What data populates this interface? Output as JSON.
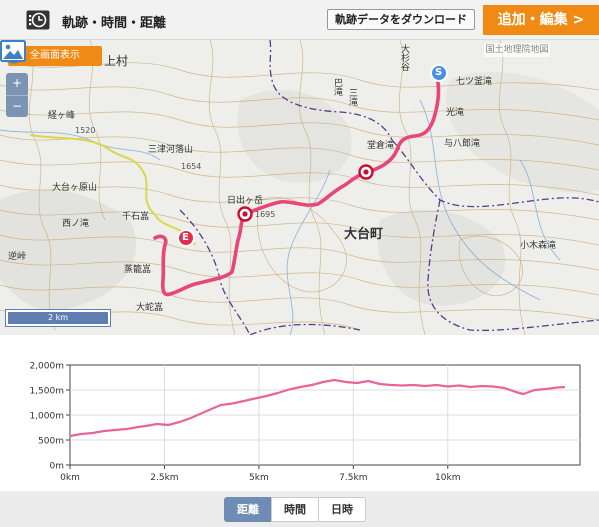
{
  "header": {
    "title": "軌跡・時間・距離",
    "download_label": "軌跡データをダウンロード",
    "edit_label": "追加・編集 >"
  },
  "map": {
    "fullscreen_label": "全画面表示",
    "zoom_in": "+",
    "zoom_out": "−",
    "attribution": "国土地理院地図",
    "scale_label": "2 km",
    "start_marker": "S",
    "end_marker": "E",
    "places": {
      "p1": "上村",
      "p2": "経ヶ峰",
      "p3": "三津河落山",
      "p4": "大台ヶ原山",
      "p5": "西ノ滝",
      "p6": "千石嵓",
      "p7": "逆峠",
      "p8": "蒸籠嵓",
      "p9": "大蛇嵓",
      "p10": "日出ヶ岳",
      "p11": "大台町",
      "p12": "堂倉滝",
      "p13": "与八郎滝",
      "p14": "光滝",
      "p15": "七ツ釜滝",
      "p16": "小木森滝",
      "p17": "巴滝",
      "p18": "三滝",
      "p19": "大杉谷"
    },
    "elevations": {
      "e1": "1520",
      "e2": "1654",
      "e3": "1695"
    }
  },
  "footer": {
    "tabs": [
      {
        "label": "距離",
        "active": true
      },
      {
        "label": "時間",
        "active": false
      },
      {
        "label": "日時",
        "active": false
      }
    ]
  },
  "colors": {
    "track": "#e8457a",
    "accent": "#ef8a14",
    "tab_active": "#6f8cb4",
    "profile": "#e8649a"
  },
  "chart_data": {
    "type": "line",
    "xlabel": "",
    "ylabel": "",
    "xlim": [
      0,
      13.5
    ],
    "ylim": [
      0,
      2000
    ],
    "x_ticks": [
      "0km",
      "2.5km",
      "5km",
      "7.5km",
      "10km"
    ],
    "y_ticks": [
      "0m",
      "500m",
      "1,000m",
      "1,500m",
      "2,000m"
    ],
    "grid": true,
    "series": [
      {
        "x": [
          0,
          0.3,
          0.6,
          0.9,
          1.2,
          1.5,
          1.8,
          2.0,
          2.3,
          2.6,
          2.9,
          3.2,
          3.5,
          3.8,
          4.0,
          4.3,
          4.6,
          4.9,
          5.2,
          5.5,
          5.8,
          6.1,
          6.4,
          6.7,
          7.0,
          7.3,
          7.6,
          7.9,
          8.2,
          8.5,
          8.8,
          9.1,
          9.4,
          9.7,
          10.0,
          10.3,
          10.6,
          10.9,
          11.2,
          11.5,
          11.8,
          12.0,
          12.3,
          12.6,
          12.9,
          13.1
        ],
        "y": [
          580,
          620,
          640,
          680,
          700,
          720,
          760,
          780,
          820,
          800,
          860,
          940,
          1040,
          1140,
          1200,
          1230,
          1280,
          1330,
          1380,
          1440,
          1510,
          1560,
          1600,
          1660,
          1700,
          1660,
          1640,
          1680,
          1620,
          1600,
          1590,
          1600,
          1580,
          1600,
          1570,
          1590,
          1560,
          1580,
          1570,
          1540,
          1460,
          1420,
          1500,
          1520,
          1550,
          1560
        ]
      }
    ]
  }
}
